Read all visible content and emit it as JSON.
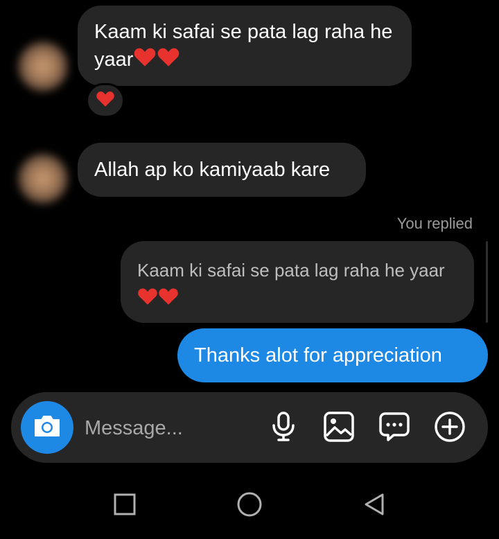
{
  "messages": [
    {
      "sender": "other",
      "text": "Kaam ki safai se pata lag raha he yaar",
      "reaction": "heart"
    },
    {
      "sender": "other",
      "text": "Allah ap ko kamiyaab kare"
    }
  ],
  "reply": {
    "label": "You replied",
    "quoted_text": "Kaam ki safai se pata lag raha he yaar",
    "sent_text": "Thanks alot for appreciation"
  },
  "composer": {
    "placeholder": "Message...",
    "icons": [
      "camera-icon",
      "microphone-icon",
      "gallery-icon",
      "sticker-icon",
      "add-icon"
    ]
  },
  "navbar": {
    "icons": [
      "recents-icon",
      "home-icon",
      "back-icon"
    ]
  },
  "colors": {
    "background": "#000000",
    "bubble_incoming": "#262626",
    "bubble_outgoing": "#1e88e5",
    "heart": "#e8322e"
  }
}
